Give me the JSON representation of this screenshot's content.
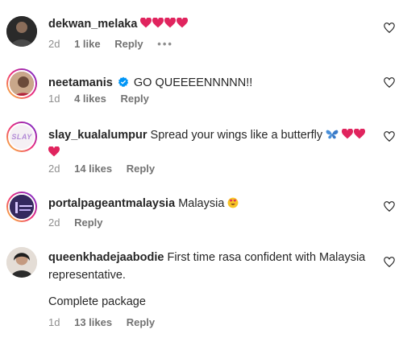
{
  "comments": [
    {
      "username": "dekwan_melaka",
      "text": "",
      "emoji_icons": [
        "red-heart-icon",
        "red-heart-icon",
        "red-heart-icon",
        "red-heart-icon"
      ],
      "time": "2d",
      "likes": "1 like",
      "reply": "Reply",
      "more": "•••"
    },
    {
      "username": "neetamanis",
      "verified": true,
      "text": "GO QUEEEENNNNN!!",
      "time": "1d",
      "likes": "4 likes",
      "reply": "Reply"
    },
    {
      "username": "slay_kualalumpur",
      "text": "Spread your wings like a butterfly",
      "emoji_icons": [
        "butterfly-icon",
        "red-heart-icon",
        "red-heart-icon",
        "red-heart-icon"
      ],
      "time": "2d",
      "likes": "14 likes",
      "reply": "Reply",
      "avatar_label": "SLAY"
    },
    {
      "username": "portalpageantmalaysia",
      "text": "Malaysia",
      "emoji_icons": [
        "heart-eyes-face-icon"
      ],
      "time": "2d",
      "reply": "Reply"
    },
    {
      "username": "queenkhadejaabodie",
      "text": "First time rasa confident with Malaysia representative.",
      "text2": "Complete package",
      "time": "1d",
      "likes": "13 likes",
      "reply": "Reply"
    }
  ],
  "like_button_icon": "heart-outline-icon",
  "colors": {
    "text": "#262626",
    "meta": "#8e8e8e",
    "heart_red": "#e0245e",
    "verified_blue": "#0095f6",
    "story_ring": "#d6249f"
  }
}
